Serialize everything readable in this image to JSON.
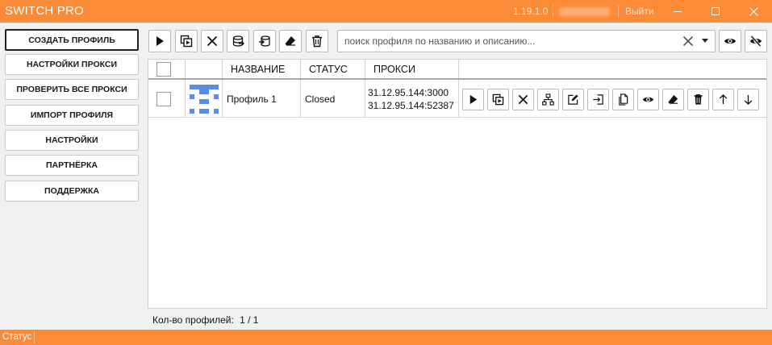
{
  "window": {
    "title": "SWITCH PRO",
    "version": "1.19.1.0",
    "logout_label": "Выйти"
  },
  "menu": {
    "items": [
      {
        "label": "СОЗДАТЬ ПРОФИЛЬ"
      },
      {
        "label": "НАСТРОЙКИ ПРОКСИ"
      },
      {
        "label": "ПРОВЕРИТЬ ВСЕ ПРОКСИ"
      },
      {
        "label": "ИМПОРТ ПРОФИЛЯ"
      },
      {
        "label": "НАСТРОЙКИ"
      },
      {
        "label": "ПАРТНЁРКА"
      },
      {
        "label": "ПОДДЕРЖКА"
      }
    ]
  },
  "toolbar": {
    "icons": [
      "play-icon",
      "copy-play-icon",
      "close-icon",
      "proxy-check-icon",
      "proxy-import-icon",
      "eraser-icon",
      "trash-icon"
    ],
    "search_placeholder": "поиск профиля по названию и описанию...",
    "search_value": "",
    "view_icons": [
      "eye-icon",
      "eye-off-icon"
    ]
  },
  "table": {
    "headers": {
      "name": "НАЗВАНИЕ",
      "status": "СТАТУС",
      "proxy": "ПРОКСИ"
    },
    "rows": [
      {
        "name": "Профиль 1",
        "status": "Closed",
        "proxy_line1": "31.12.95.144:3000",
        "proxy_line2": "31.12.95.144:52387",
        "avatar_color": "#5b8de6"
      }
    ],
    "row_actions": [
      "play-icon",
      "copy-play-icon",
      "close-icon",
      "network-icon",
      "edit-icon",
      "export-icon",
      "clone-icon",
      "eye-icon",
      "eraser-icon",
      "trash-icon",
      "arrow-up-icon",
      "arrow-down-icon"
    ]
  },
  "footer": {
    "count_label": "Кол-во профилей:",
    "count_value": "1 / 1"
  },
  "statusbar": {
    "text": "Статус"
  },
  "colors": {
    "accent": "#fb8b36",
    "avatar": "#5b8de6"
  }
}
